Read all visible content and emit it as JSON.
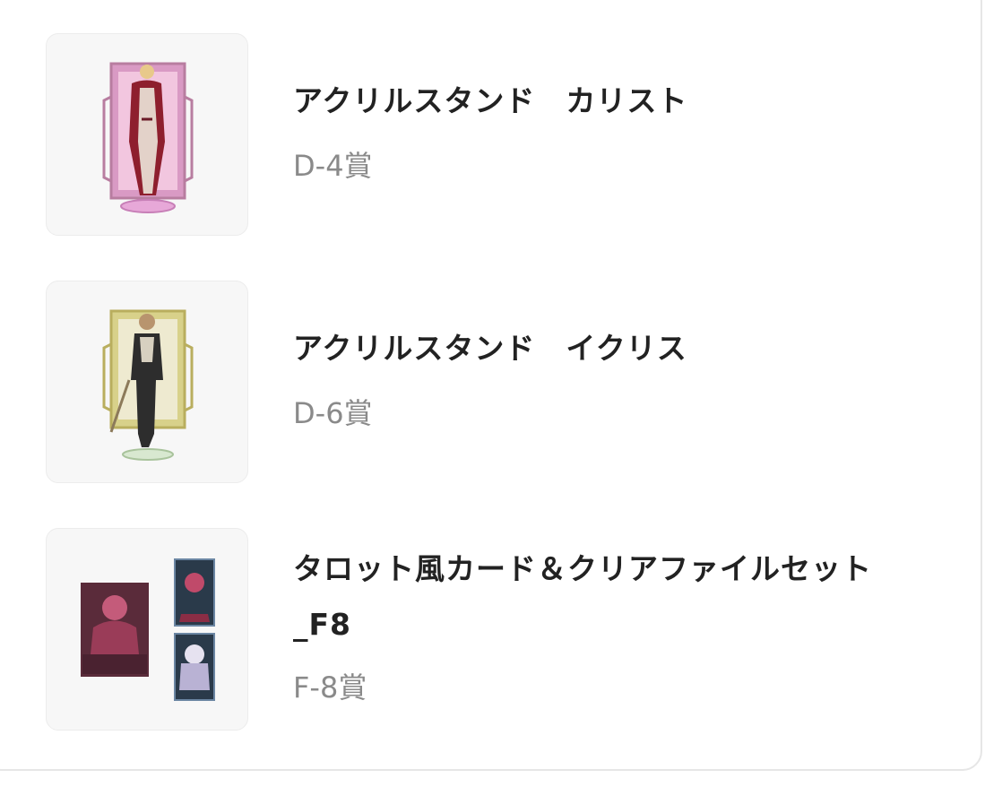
{
  "items": [
    {
      "title": "アクリルスタンド　カリスト",
      "prize": "D-4賞",
      "image": "acrylic-stand-callisto-image",
      "accent": "#c96aa6"
    },
    {
      "title": "アクリルスタンド　イクリス",
      "prize": "D-6賞",
      "image": "acrylic-stand-ikuris-image",
      "accent": "#c8bf6a"
    },
    {
      "title_line1": "タロット風カード＆クリアファイルセット",
      "title_line2": "_F8",
      "prize": "F-8賞",
      "image": "tarot-card-clearfile-set-image",
      "accent": "#7a3a52"
    }
  ]
}
